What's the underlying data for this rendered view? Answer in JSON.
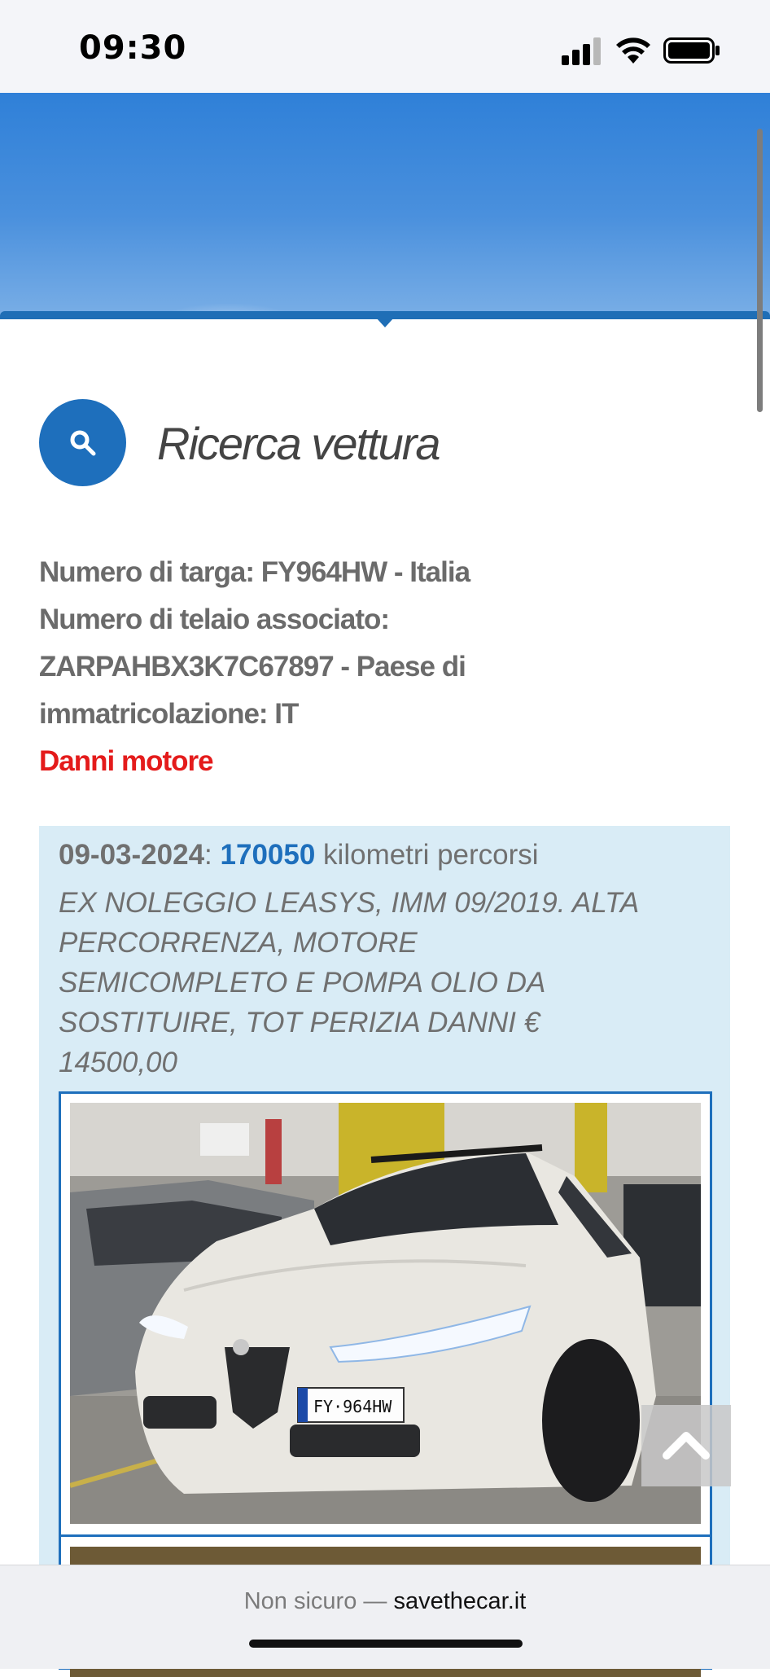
{
  "status_bar": {
    "time": "09:30",
    "icons": [
      "cellular-signal-icon",
      "wifi-icon",
      "battery-icon"
    ]
  },
  "search": {
    "icon": "search-icon",
    "title": "Ricerca vettura"
  },
  "vehicle": {
    "plate_line": "Numero di targa: FY964HW - Italia",
    "vin_line_1": "Numero di telaio associato:",
    "vin_line_2": "ZARPAHBX3K7C67897 - Paese di",
    "vin_line_3": "immatricolazione: IT",
    "damage": "Danni motore"
  },
  "record": {
    "date": "09-03-2024",
    "separator": ":",
    "km": "170050",
    "km_label": "kilometri percorsi",
    "description_lines": [
      "EX NOLEGGIO LEASYS, IMM 09/2019. ALTA",
      "PERCORRENZA, MOTORE",
      "SEMICOMPLETO E POMPA OLIO DA",
      "SOSTITUIRE, TOT PERIZIA DANNI €",
      "14500,00"
    ],
    "photo_plate": "FY·964HW"
  },
  "browser": {
    "not_secure": "Non sicuro —",
    "domain": "savethecar.it"
  },
  "colors": {
    "accent": "#1e6fbc",
    "danger": "#e41b1b",
    "card_bg": "#d9ecf6"
  }
}
